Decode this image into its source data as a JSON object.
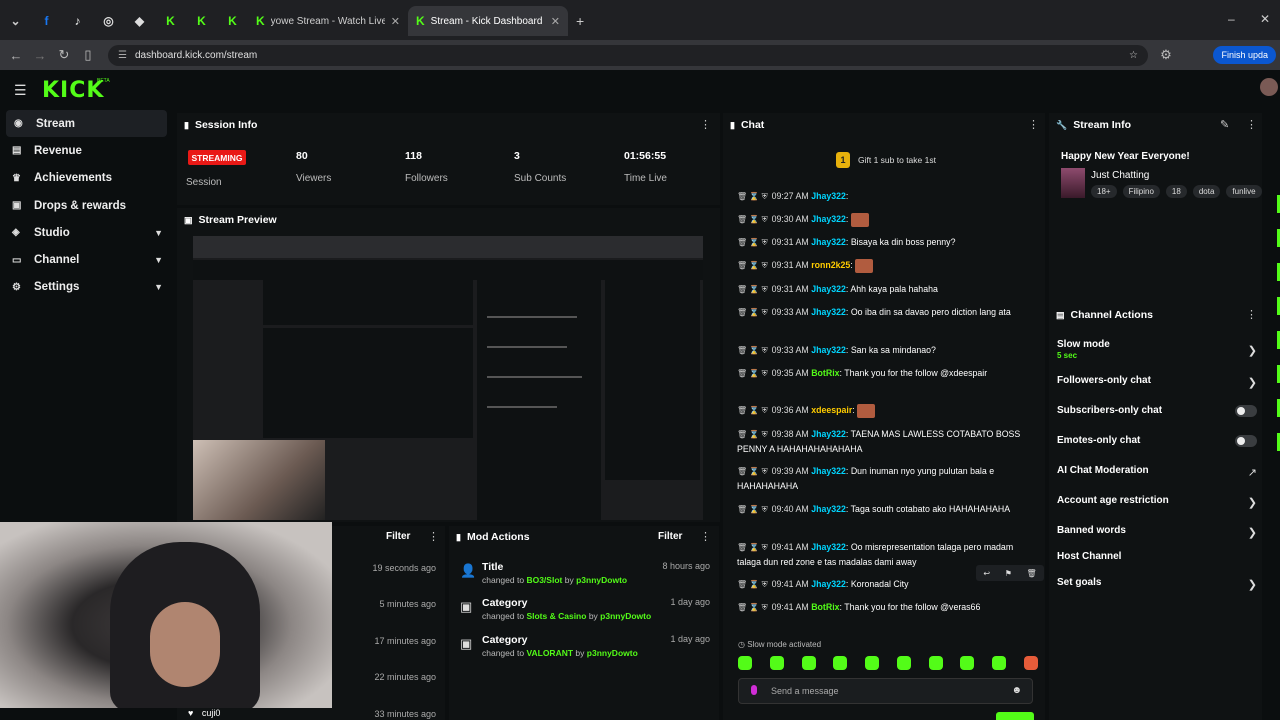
{
  "browser": {
    "tabs": [
      {
        "label": "yowe Stream - Watch Live on K"
      },
      {
        "label": "Stream - Kick Dashboard"
      }
    ],
    "url": "dashboard.kick.com/stream",
    "finish_update": "Finish upda"
  },
  "logo": "KICK",
  "beta": "BETA",
  "sidebar": {
    "items": [
      {
        "label": "Stream",
        "icon": "broadcast-icon"
      },
      {
        "label": "Revenue",
        "icon": "money-icon"
      },
      {
        "label": "Achievements",
        "icon": "trophy-icon"
      },
      {
        "label": "Drops & rewards",
        "icon": "gift-icon"
      },
      {
        "label": "Studio",
        "icon": "studio-icon"
      },
      {
        "label": "Channel",
        "icon": "channel-icon"
      },
      {
        "label": "Settings",
        "icon": "gear-icon"
      }
    ]
  },
  "session": {
    "title": "Session Info",
    "badge": "STREAMING",
    "session_label": "Session",
    "stats": [
      {
        "value": "80",
        "label": "Viewers"
      },
      {
        "value": "118",
        "label": "Followers"
      },
      {
        "value": "3",
        "label": "Sub Counts"
      },
      {
        "value": "01:56:55",
        "label": "Time Live"
      }
    ]
  },
  "preview": {
    "title": "Stream Preview"
  },
  "activity": {
    "filter": "Filter",
    "times": [
      "19 seconds ago",
      "5 minutes ago",
      "17 minutes ago",
      "22 minutes ago",
      "33 minutes ago"
    ],
    "last_user": "cuji0"
  },
  "mod_actions": {
    "title": "Mod Actions",
    "filter": "Filter",
    "items": [
      {
        "title": "Title",
        "prefix": "changed to",
        "value": "BO3/Slot",
        "by": "by",
        "user": "p3nnyDowto",
        "time": "8 hours ago"
      },
      {
        "title": "Category",
        "prefix": "changed to",
        "value": "Slots & Casino",
        "by": "by",
        "user": "p3nnyDowto",
        "time": "1 day ago"
      },
      {
        "title": "Category",
        "prefix": "changed to",
        "value": "VALORANT",
        "by": "by",
        "user": "p3nnyDowto",
        "time": "1 day ago"
      }
    ]
  },
  "chat": {
    "title": "Chat",
    "gift": "Gift 1 sub to take 1st",
    "gift_count": "1",
    "messages": [
      {
        "time": "09:27 AM",
        "user": "Jhay322",
        "color": "#00d5ff",
        "text": ""
      },
      {
        "time": "09:30 AM",
        "user": "Jhay322",
        "color": "#00d5ff",
        "text": "",
        "emote": true
      },
      {
        "time": "09:31 AM",
        "user": "Jhay322",
        "color": "#00d5ff",
        "text": "Bisaya ka din boss penny?"
      },
      {
        "time": "09:31 AM",
        "user": "ronn2k25",
        "color": "#ffcc00",
        "text": "",
        "emote": true
      },
      {
        "time": "09:31 AM",
        "user": "Jhay322",
        "color": "#00d5ff",
        "text": "Ahh kaya pala hahaha"
      },
      {
        "time": "09:33 AM",
        "user": "Jhay322",
        "color": "#00d5ff",
        "text": "Oo iba din sa davao pero diction lang ata"
      },
      {
        "time": "09:33 AM",
        "user": "Jhay322",
        "color": "#00d5ff",
        "text": "San ka sa mindanao?"
      },
      {
        "time": "09:35 AM",
        "user": "BotRix",
        "color": "#53fc18",
        "text": "Thank you for the follow @xdeespair"
      },
      {
        "time": "09:36 AM",
        "user": "xdeespair",
        "color": "#ffcc00",
        "text": "",
        "emote": true
      },
      {
        "time": "09:38 AM",
        "user": "Jhay322",
        "color": "#00d5ff",
        "text": "TAENA MAS LAWLESS COTABATO BOSS PENNY A HAHAHAHAHAHAHA"
      },
      {
        "time": "09:39 AM",
        "user": "Jhay322",
        "color": "#00d5ff",
        "text": "Dun inuman nyo yung pulutan bala e HAHAHAHAHA"
      },
      {
        "time": "09:40 AM",
        "user": "Jhay322",
        "color": "#00d5ff",
        "text": "Taga south cotabato ako HAHAHAHAHA"
      },
      {
        "time": "09:41 AM",
        "user": "Jhay322",
        "color": "#00d5ff",
        "text": "Oo misrepresentation talaga pero madam talaga dun red zone e tas madalas dami away"
      },
      {
        "time": "09:41 AM",
        "user": "Jhay322",
        "color": "#00d5ff",
        "text": "Koronadal City"
      },
      {
        "time": "09:41 AM",
        "user": "BotRix",
        "color": "#53fc18",
        "text": "Thank you for the follow @veras66"
      }
    ],
    "slow_mode": "Slow mode activated",
    "input_placeholder": "Send a message"
  },
  "stream_info": {
    "title": "Stream Info",
    "stream_title": "Happy New Year Everyone!",
    "category": "Just Chatting",
    "tags": [
      "18+",
      "Filipino",
      "18",
      "dota",
      "funlive"
    ]
  },
  "channel_actions": {
    "title": "Channel Actions",
    "items": [
      {
        "label": "Slow mode",
        "sub": "5 sec",
        "control": "chevron"
      },
      {
        "label": "Followers-only chat",
        "control": "chevron"
      },
      {
        "label": "Subscribers-only chat",
        "control": "toggle"
      },
      {
        "label": "Emotes-only chat",
        "control": "toggle"
      },
      {
        "label": "AI Chat Moderation",
        "control": "external"
      },
      {
        "label": "Account age restriction",
        "control": "chevron"
      },
      {
        "label": "Banned words",
        "control": "chevron"
      },
      {
        "label": "Host Channel",
        "control": "none"
      },
      {
        "label": "Set goals",
        "control": "chevron"
      }
    ]
  },
  "colors": {
    "brand": "#53fc18",
    "live": "#e91916",
    "bg": "#0b0e0f",
    "panel": "#0f1213"
  }
}
